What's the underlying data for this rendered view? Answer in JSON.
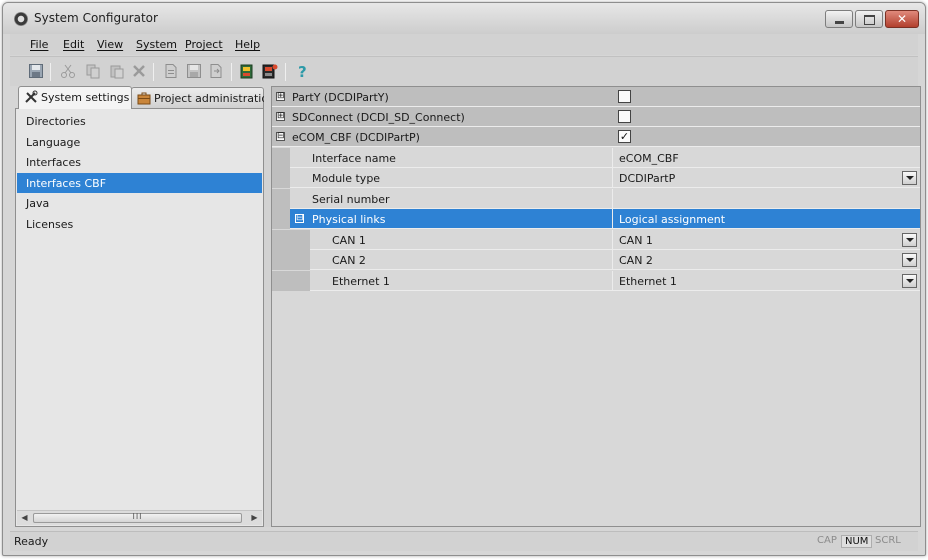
{
  "window": {
    "title": "System Configurator"
  },
  "menu": [
    "File",
    "Edit",
    "View",
    "System",
    "Project",
    "Help"
  ],
  "toolbar": {
    "icons": [
      "save-icon",
      "cut-icon",
      "copy-icon",
      "paste-icon",
      "delete-icon",
      "new-icon",
      "save-as-icon",
      "export-icon",
      "import-icon",
      "download-icon",
      "help-icon"
    ]
  },
  "tabs": [
    {
      "label": "System settings",
      "icon": "tools-icon"
    },
    {
      "label": "Project administration",
      "icon": "briefcase-icon"
    }
  ],
  "nav": {
    "items": [
      "Directories",
      "Language",
      "Interfaces",
      "Interfaces CBF",
      "Java",
      "Licenses"
    ],
    "selected": "Interfaces CBF"
  },
  "scrollbar": {
    "grip": "III"
  },
  "grid": {
    "rows": [
      {
        "label": "PartY (DCDIPartY)",
        "checked": false
      },
      {
        "label": "SDConnect (DCDI_SD_Connect)",
        "checked": false
      },
      {
        "label": "eCOM_CBF (DCDIPartP)",
        "checked": true
      },
      {
        "label": "Interface name",
        "value": "eCOM_CBF"
      },
      {
        "label": "Module type",
        "value": "DCDIPartP"
      },
      {
        "label": "Serial number",
        "value": ""
      },
      {
        "label": "Physical links",
        "value": "Logical assignment"
      },
      {
        "label": "CAN 1",
        "value": "CAN 1"
      },
      {
        "label": "CAN 2",
        "value": "CAN 2"
      },
      {
        "label": "Ethernet 1",
        "value": "Ethernet 1"
      }
    ],
    "expand_glyph": "⊞",
    "collapse_glyph": "⊟",
    "check_glyph": "✓"
  },
  "status": {
    "text": "Ready",
    "indicators": [
      {
        "label": "CAP",
        "active": false
      },
      {
        "label": "NUM",
        "active": true
      },
      {
        "label": "SCRL",
        "active": false
      }
    ]
  },
  "colors": {
    "selection": "#2e82d4",
    "category_row": "#bebebe",
    "background": "#d6d6d6"
  }
}
